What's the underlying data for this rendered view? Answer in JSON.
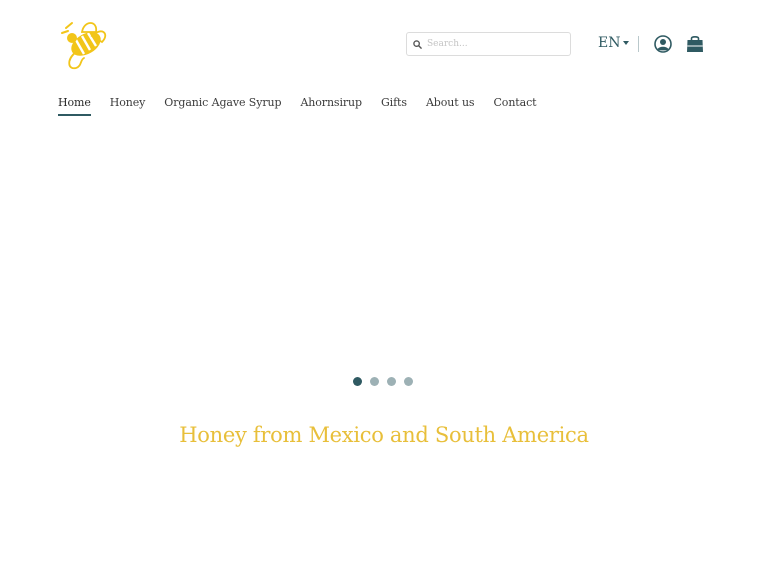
{
  "header": {
    "logo_icon": "bee-logo-icon",
    "search": {
      "icon": "search-icon",
      "placeholder": "Search...",
      "value": ""
    },
    "language": {
      "label": "EN",
      "icon": "caret-down-icon"
    },
    "account_icon": "user-circle-icon",
    "cart_icon": "shopping-bag-icon"
  },
  "nav": {
    "items": [
      {
        "label": "Home",
        "active": true
      },
      {
        "label": "Honey",
        "active": false
      },
      {
        "label": "Organic Agave Syrup",
        "active": false
      },
      {
        "label": "Ahornsirup",
        "active": false
      },
      {
        "label": "Gifts",
        "active": false
      },
      {
        "label": "About us",
        "active": false
      },
      {
        "label": "Contact",
        "active": false
      }
    ]
  },
  "carousel": {
    "slide_count": 4,
    "active_index": 0
  },
  "hero": {
    "headline": "Honey from Mexico and South America"
  },
  "colors": {
    "accent": "#2f5a62",
    "brand_yellow": "#e8bf3a"
  }
}
